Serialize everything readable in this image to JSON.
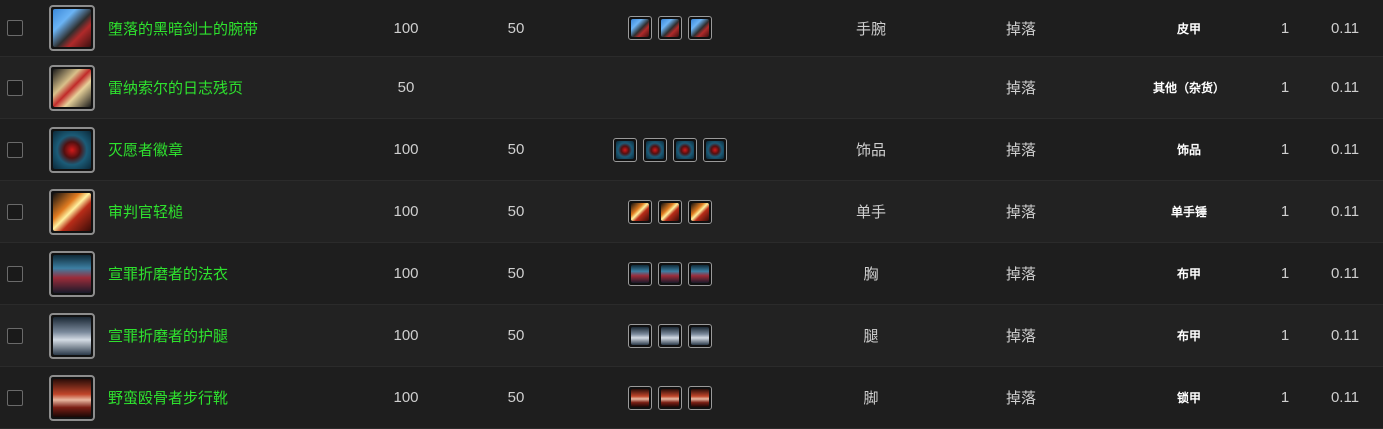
{
  "rows": [
    {
      "name": "堕落的黑暗剑士的腕带",
      "req": "100",
      "lvl": "50",
      "slot": "手腕",
      "source": "掉落",
      "type": "皮甲",
      "count": "1",
      "rate": "0.11",
      "icon": "bracer-icon",
      "variant_count": 3
    },
    {
      "name": "雷纳索尔的日志残页",
      "req": "50",
      "lvl": "",
      "slot": "",
      "source": "掉落",
      "type": "其他（杂货）",
      "count": "1",
      "rate": "0.11",
      "icon": "scroll-icon",
      "variant_count": 0
    },
    {
      "name": "灭愿者徽章",
      "req": "100",
      "lvl": "50",
      "slot": "饰品",
      "source": "掉落",
      "type": "饰品",
      "count": "1",
      "rate": "0.11",
      "icon": "insignia-icon",
      "variant_count": 4
    },
    {
      "name": "审判官轻槌",
      "req": "100",
      "lvl": "50",
      "slot": "单手",
      "source": "掉落",
      "type": "单手锤",
      "count": "1",
      "rate": "0.11",
      "icon": "mace-icon",
      "variant_count": 3
    },
    {
      "name": "宣罪折磨者的法衣",
      "req": "100",
      "lvl": "50",
      "slot": "胸",
      "source": "掉落",
      "type": "布甲",
      "count": "1",
      "rate": "0.11",
      "icon": "robe-icon",
      "variant_count": 3
    },
    {
      "name": "宣罪折磨者的护腿",
      "req": "100",
      "lvl": "50",
      "slot": "腿",
      "source": "掉落",
      "type": "布甲",
      "count": "1",
      "rate": "0.11",
      "icon": "legs-icon",
      "variant_count": 3
    },
    {
      "name": "野蛮殴骨者步行靴",
      "req": "100",
      "lvl": "50",
      "slot": "脚",
      "source": "掉落",
      "type": "锁甲",
      "count": "1",
      "rate": "0.11",
      "icon": "boots-icon",
      "variant_count": 3
    }
  ]
}
